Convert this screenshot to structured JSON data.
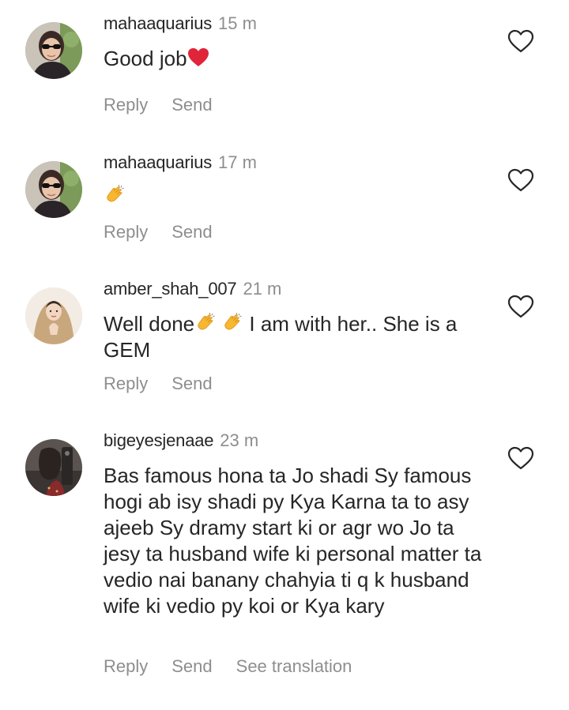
{
  "comments": [
    {
      "username": "mahaaquarius",
      "time": "15 m",
      "text_before": "Good job",
      "emoji": "heart-emoji",
      "text_after": "",
      "actions": [
        "Reply",
        "Send"
      ]
    },
    {
      "username": "mahaaquarius",
      "time": "17 m",
      "text_before": "",
      "emoji": "clapping-hands-emoji",
      "text_after": "",
      "actions": [
        "Reply",
        "Send"
      ]
    },
    {
      "username": "amber_shah_007",
      "time": "21 m",
      "text_before": "Well done",
      "emoji": "clapping-hands-emoji x2",
      "text_after": " I am with her.. She is a GEM",
      "actions": [
        "Reply",
        "Send"
      ]
    },
    {
      "username": "bigeyesjenaae",
      "time": "23 m",
      "text_before": "Bas famous hona ta Jo shadi Sy famous hogi ab isy shadi py Kya Karna ta to asy ajeeb Sy dramy start ki or agr wo Jo ta jesy ta husband wife ki personal matter ta vedio nai banany chahyia ti q k husband wife ki vedio py koi or Kya kary",
      "emoji": "",
      "text_after": "",
      "actions": [
        "Reply",
        "Send",
        "See translation"
      ]
    }
  ],
  "colors": {
    "text": "#262626",
    "secondary": "#8e8e8e",
    "heart_emoji": "#e0243a",
    "clap_emoji": "#f7b731"
  },
  "icons": {
    "like": "heart-outline-icon"
  }
}
